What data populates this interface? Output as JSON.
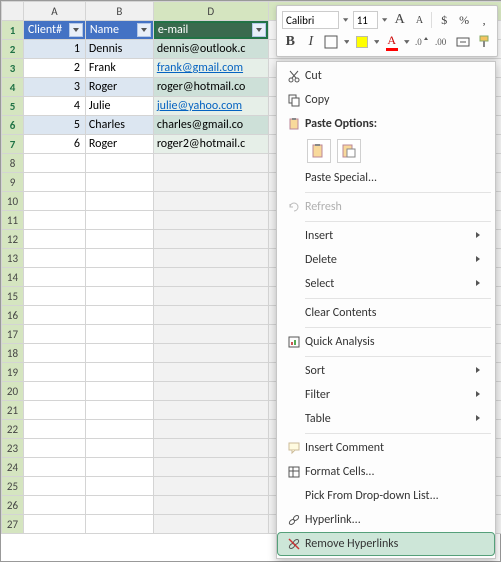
{
  "columns": [
    "A",
    "B",
    "D"
  ],
  "rows": [
    "1",
    "2",
    "3",
    "4",
    "5",
    "6",
    "7",
    "8",
    "9",
    "10",
    "11",
    "12",
    "13",
    "14",
    "15",
    "16",
    "17",
    "18",
    "19",
    "20",
    "21",
    "22",
    "23",
    "24",
    "25",
    "26",
    "27"
  ],
  "headers": {
    "client": "Client#",
    "name": "Name",
    "email": "e-mail"
  },
  "data": [
    {
      "num": "1",
      "name": "Dennis",
      "email": "dennis@outlook.c",
      "link": false
    },
    {
      "num": "2",
      "name": "Frank",
      "email": "frank@gmail.com",
      "link": true
    },
    {
      "num": "3",
      "name": "Roger",
      "email": "roger@hotmail.co",
      "link": false
    },
    {
      "num": "4",
      "name": "Julie",
      "email": "julie@yahoo.com",
      "link": true
    },
    {
      "num": "5",
      "name": "Charles",
      "email": "charles@gmail.co",
      "link": false
    },
    {
      "num": "6",
      "name": "Roger",
      "email": "roger2@hotmail.c",
      "link": false
    }
  ],
  "bg_url": "http://www.ablebits.com",
  "mini": {
    "font": "Calibri",
    "size": "11",
    "grow": "A",
    "shrink": "A",
    "bold": "B",
    "italic": "I",
    "dollar": "$",
    "percent": "%",
    "comma": ","
  },
  "ctx": {
    "cut": "Cut",
    "copy": "Copy",
    "paste_options": "Paste Options:",
    "paste_special": "Paste Special...",
    "refresh": "Refresh",
    "insert": "Insert",
    "delete": "Delete",
    "select": "Select",
    "clear": "Clear Contents",
    "quick": "Quick Analysis",
    "sort": "Sort",
    "filter": "Filter",
    "table": "Table",
    "comment": "Insert Comment",
    "format": "Format Cells...",
    "pick": "Pick From Drop-down List...",
    "hyperlink": "Hyperlink...",
    "remove_hyper": "Remove Hyperlinks"
  }
}
